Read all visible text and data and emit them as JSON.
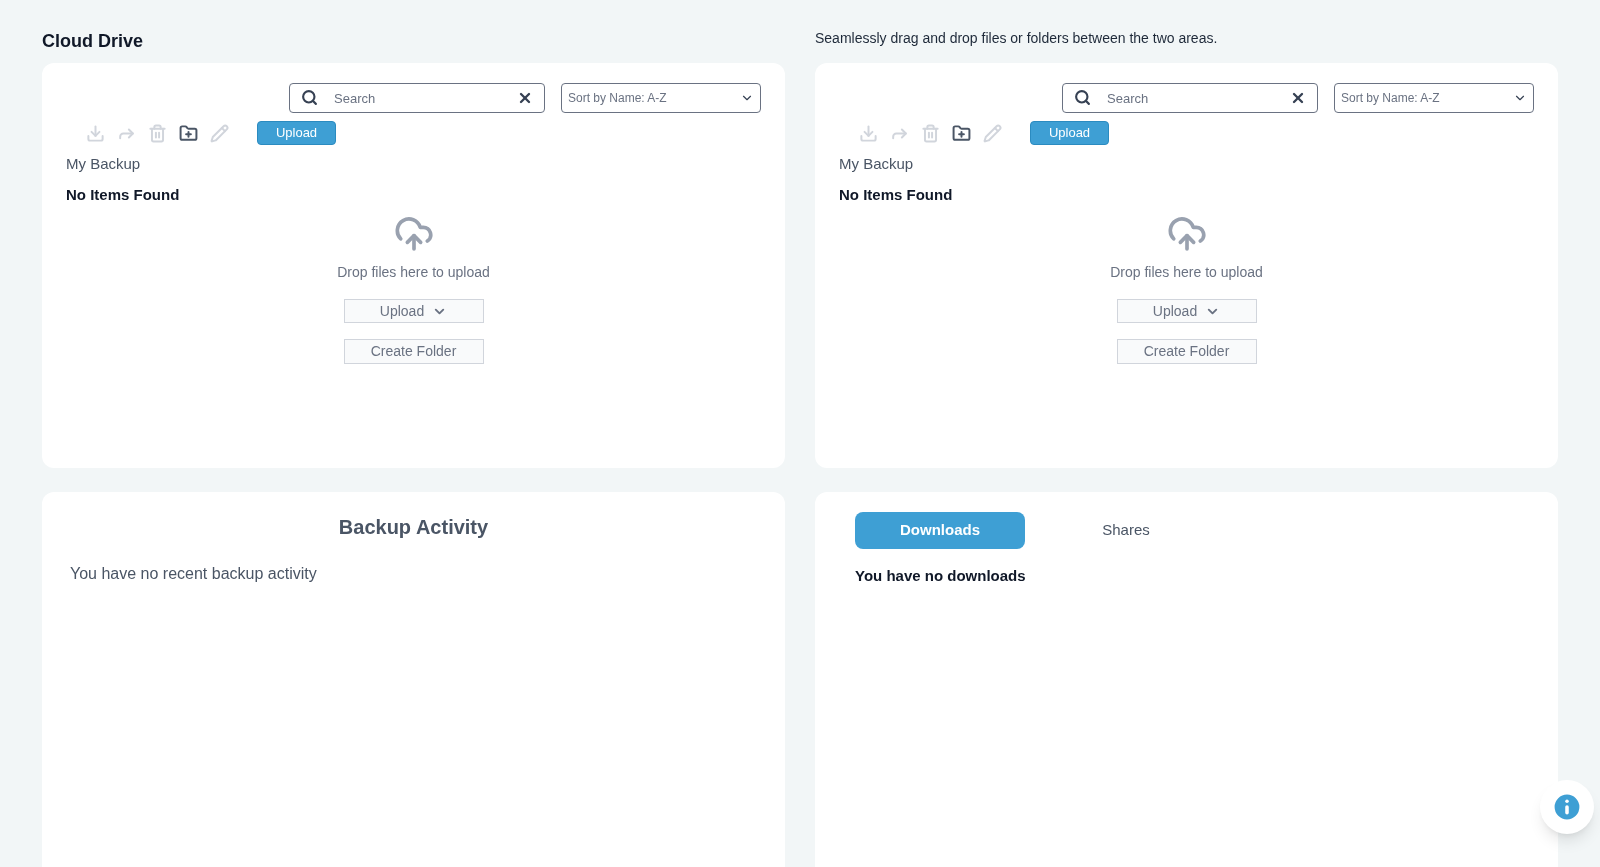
{
  "header": {
    "title": "Cloud Drive",
    "hint": "Seamlessly drag and drop files or folders between the two areas."
  },
  "drives": [
    {
      "search": {
        "placeholder": "Search"
      },
      "sort": "Sort by Name: A-Z",
      "toolbar": [
        {
          "kind": "download",
          "disabled": true
        },
        {
          "kind": "share",
          "disabled": true
        },
        {
          "kind": "delete",
          "disabled": true
        },
        {
          "kind": "new-folder",
          "disabled": false
        },
        {
          "kind": "rename",
          "disabled": true
        }
      ],
      "upload_button": "Upload",
      "breadcrumb": "My Backup",
      "empty_title": "No Items Found",
      "drop_hint": "Drop files here to upload",
      "upload_menu": "Upload",
      "create_folder": "Create Folder"
    },
    {
      "search": {
        "placeholder": "Search"
      },
      "sort": "Sort by Name: A-Z",
      "toolbar": [
        {
          "kind": "download",
          "disabled": true
        },
        {
          "kind": "share",
          "disabled": true
        },
        {
          "kind": "delete",
          "disabled": true
        },
        {
          "kind": "new-folder",
          "disabled": false
        },
        {
          "kind": "rename",
          "disabled": true
        }
      ],
      "upload_button": "Upload",
      "breadcrumb": "My Backup",
      "empty_title": "No Items Found",
      "drop_hint": "Drop files here to upload",
      "upload_menu": "Upload",
      "create_folder": "Create Folder"
    }
  ],
  "activity": {
    "title": "Backup Activity",
    "message": "You have no recent backup activity"
  },
  "transfers": {
    "tabs": [
      {
        "label": "Downloads",
        "selected": true
      },
      {
        "label": "Shares",
        "selected": false
      }
    ],
    "message": "You have no downloads"
  }
}
